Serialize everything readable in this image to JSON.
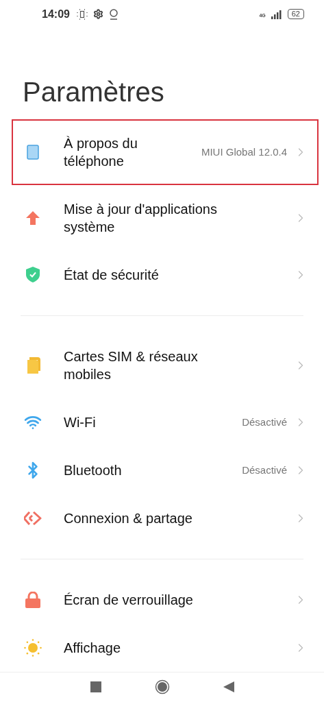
{
  "status_bar": {
    "time": "14:09",
    "network": "4G",
    "battery": "62"
  },
  "title": "Paramètres",
  "groups": [
    {
      "items": [
        {
          "kind": "phone",
          "label": "À propos du téléphone",
          "value": "MIUI Global 12.0.4",
          "highlighted": true
        },
        {
          "kind": "update",
          "label": "Mise à jour d'applications système",
          "highlighted": false
        },
        {
          "kind": "shield",
          "label": "État de sécurité",
          "highlighted": false
        }
      ]
    },
    {
      "items": [
        {
          "kind": "sim",
          "label": "Cartes SIM & réseaux mobiles",
          "highlighted": false
        },
        {
          "kind": "wifi",
          "label": "Wi-Fi",
          "value": "Désactivé",
          "highlighted": false
        },
        {
          "kind": "bluetooth",
          "label": "Bluetooth",
          "value": "Désactivé",
          "highlighted": false
        },
        {
          "kind": "share",
          "label": "Connexion & partage",
          "highlighted": false
        }
      ]
    },
    {
      "items": [
        {
          "kind": "lock",
          "label": "Écran de verrouillage",
          "highlighted": false
        },
        {
          "kind": "display",
          "label": "Affichage",
          "highlighted": false
        }
      ]
    }
  ]
}
